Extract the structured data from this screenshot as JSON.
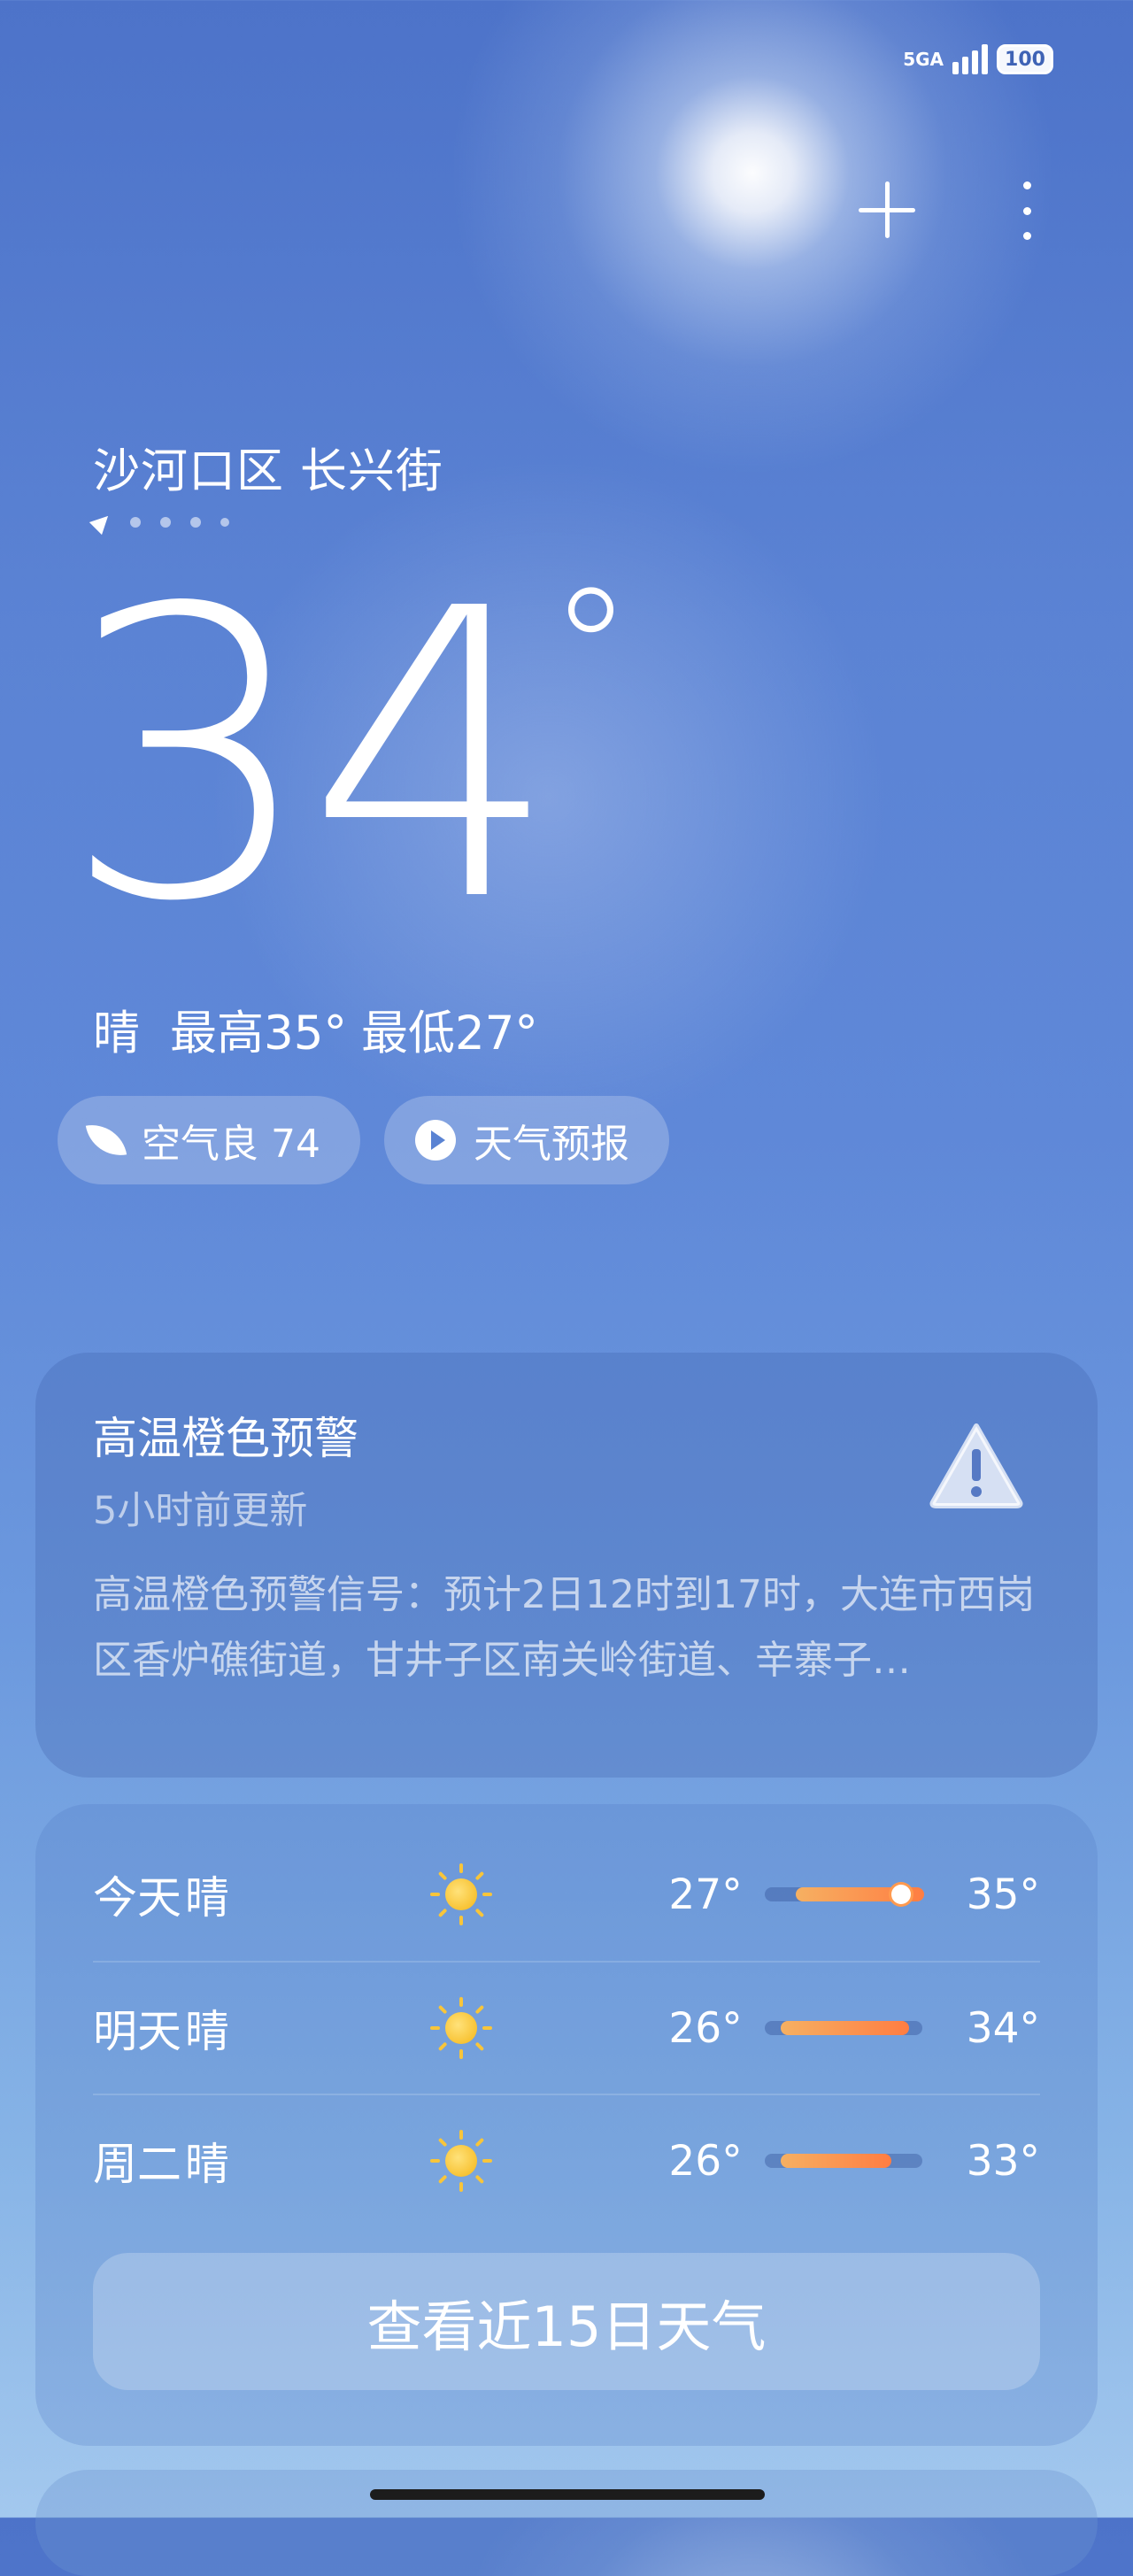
{
  "status": {
    "network": "5GA",
    "battery": "100"
  },
  "toolbar": {
    "add_icon": "plus-icon",
    "more_icon": "more-vertical-icon"
  },
  "location": {
    "name": "沙河口区 长兴街"
  },
  "current": {
    "temperature": "34",
    "unit": "°",
    "condition": "晴",
    "high": "最高35°",
    "low": "最低27°"
  },
  "chips": {
    "air": "空气良 74",
    "forecast": "天气预报"
  },
  "alert": {
    "title": "高温橙色预警",
    "updated": "5小时前更新",
    "body": "高温橙色预警信号：预计2日12时到17时，大连市西岗区香炉礁街道，甘井子区南关岭街道、辛寨子…"
  },
  "forecast": {
    "days": [
      {
        "day": "今天",
        "condition": "晴",
        "low": "27°",
        "high": "35°"
      },
      {
        "day": "明天",
        "condition": "晴",
        "low": "26°",
        "high": "34°"
      },
      {
        "day": "周二",
        "condition": "晴",
        "low": "26°",
        "high": "33°"
      }
    ],
    "button": "查看近15日天气"
  }
}
